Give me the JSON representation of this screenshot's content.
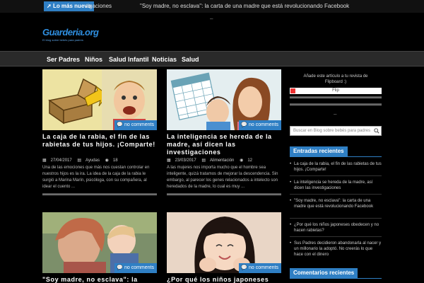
{
  "ticker": {
    "badge": "Lo más nuevo",
    "prev_text": "tigaciones",
    "text_quote": "\"Soy madre, no esclava\"",
    "text_rest": ": la carta de una madre que está revolucionando Facebook"
  },
  "header": {
    "dash": "–",
    "logo_text": "Guarderia.org",
    "logo_tag": "El blog sobre bebés para padres"
  },
  "nav": {
    "items": [
      "Ser Padres",
      "Niños",
      "Salud Infantil",
      "Noticias",
      "Salud"
    ]
  },
  "posts": [
    {
      "comments": "no comments",
      "title": "La caja de la rabia, el fin de las rabietas de tus hijos. ¡Comparte!",
      "date": "27/04/2017",
      "category": "Ayudas",
      "count": "18",
      "excerpt": "Una de las emociones que más nos cuestan controlar en nuestros hijos es la ira. La idea de la caja de la rabia le surgió a Marina Marín, psicóloga, con su compañera, al idear el cuento ..."
    },
    {
      "comments": "no comments",
      "title": "La inteligencia se hereda de la madre, así dicen las investigaciones",
      "date": "23/03/2017",
      "category": "Alimentación",
      "count": "12",
      "excerpt": "A las mujeres nos importa mucho que el hombre sea inteligente, quizá tratamos de mejorar la descendencia. Sin embargo, al parecer los genes relacionados a intelecto son heredados de la madre, lo cual es muy ..."
    },
    {
      "comments": "no comments",
      "title": "\"Soy madre, no esclava\": la"
    },
    {
      "comments": "no comments",
      "title": "¿Por qué los niños japoneses"
    }
  ],
  "sidebar": {
    "flip_text": "Añade este artículo a tu revista de Flipboard :)",
    "flip_button": "Flip",
    "dash": "–",
    "search_placeholder": "Buscar en Blog sobre bebés para padres",
    "recent_heading": "Entradas recientes",
    "recent": [
      "La caja de la rabia, el fin de las rabietas de tus hijos. ¡Comparte!",
      "La inteligencia se hereda de la madre, así dicen las investigaciones",
      "\"Soy madre, no esclava\": la carta de una madre que está revolucionando Facebook",
      "¿Por qué los niños japoneses obedecen y no hacen rabietas?",
      "Sus Padres decidieron abandonarla al nacer y un millonario la adoptó. No creerás lo que hace con el dinero"
    ],
    "comments_heading": "Comentarios recientes"
  },
  "colors": {
    "accent": "#2f7fc4",
    "background": "#000000",
    "nav": "#2a2a2a"
  }
}
